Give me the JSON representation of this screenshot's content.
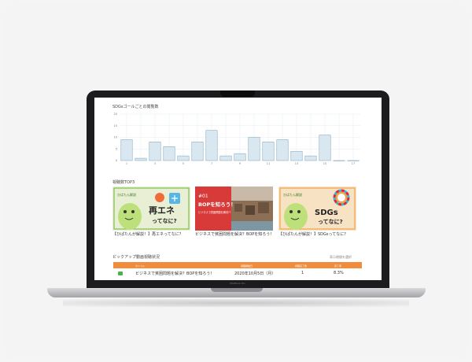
{
  "device": {
    "model_label": "MacBook Pro"
  },
  "colors": {
    "accent_orange": "#f08c3a",
    "bar_fill": "#d8e7f0",
    "bar_stroke": "#7aa2b8",
    "grid": "#e2ecf1",
    "play_green": "#4caf50"
  },
  "chart_section": {
    "title": "SDGsゴールごとの閲覧数"
  },
  "chart_data": {
    "type": "bar",
    "categories": [
      "1",
      "2",
      "3",
      "4",
      "5",
      "6",
      "7",
      "8",
      "9",
      "10",
      "11",
      "12",
      "13",
      "14",
      "15",
      "16",
      "17"
    ],
    "tick_labels_shown": [
      "1",
      "",
      "3",
      "",
      "5",
      "",
      "7",
      "",
      "9",
      "",
      "11",
      "",
      "13",
      "",
      "15",
      "",
      "17"
    ],
    "values": [
      9,
      1,
      8,
      6,
      2,
      8,
      13,
      2,
      3,
      10,
      8,
      9,
      4,
      2,
      11,
      0,
      0
    ],
    "ylim": [
      0,
      20
    ],
    "yticks": [
      "20",
      "15",
      "10",
      "5",
      "0"
    ],
    "grid": true
  },
  "popular_section": {
    "title": "視聴数TOP3",
    "items": [
      {
        "thumb_big": "再エネ",
        "thumb_small": "ってなに?",
        "thumb_top": "ひぱたん解説",
        "caption": "【ひぱたんが解説！】再エネってなに？"
      },
      {
        "thumb_big": "BOPを知ろう！",
        "thumb_small": "#01",
        "thumb_top": "ビジネスで貧困問題を解決!?",
        "caption": "ビジネスで貧困問題を解決？BOPを知ろう！"
      },
      {
        "thumb_big": "SDGs",
        "thumb_small": "ってなに?",
        "thumb_top": "ひぱたん解説",
        "caption": "【ひぱたんが解説！】SDGsってなに？"
      }
    ]
  },
  "pickup_section": {
    "title": "ピックアップ動画視聴状況",
    "sub_tag": "表示期間を選択",
    "columns": [
      "タイトル",
      "視聴開始日",
      "視聴完了数",
      "完了率"
    ],
    "rows": [
      {
        "title": "ビジネスで貧困問題を解決？BOPを知ろう！",
        "date": "2020年10月5日（月）",
        "count": "1",
        "rate": "8.3%"
      }
    ]
  }
}
